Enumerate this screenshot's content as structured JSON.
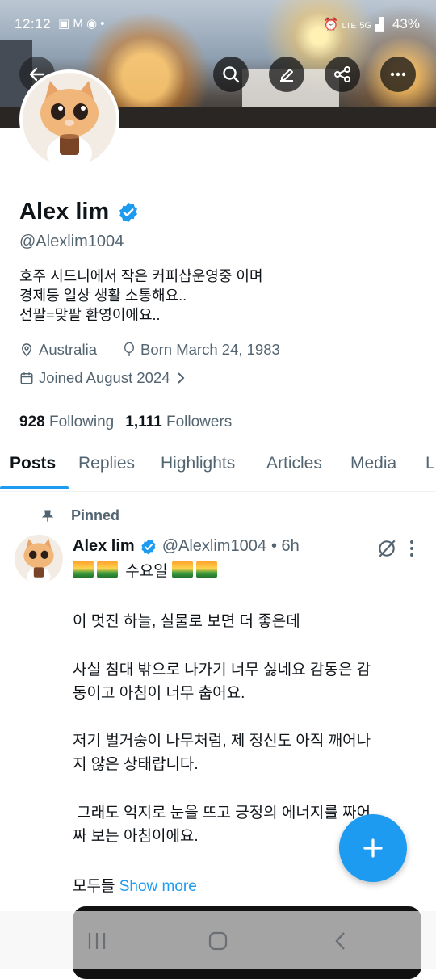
{
  "status_bar": {
    "time": "12:12",
    "left_icons": [
      "image-icon",
      "gmail-icon",
      "chat-icon",
      "dot-icon"
    ],
    "right_icons": [
      "alarm-icon",
      "volte-icon",
      "5g-icon",
      "signal-icon"
    ],
    "battery": "43%"
  },
  "top_actions": [
    "back-icon",
    "search-icon",
    "edit-icon",
    "share-icon",
    "more-icon"
  ],
  "profile": {
    "name": "Alex lim",
    "handle": "@Alexlim1004",
    "bio": "호주 시드니에서 작은 커피샵운영중 이며\n 경제등 일상 생활 소통해요..\n선팔=맞팔 환영이에요..",
    "location": "Australia",
    "born": "Born March 24, 1983",
    "joined": "Joined August 2024",
    "following_count": "928",
    "following_label": "Following",
    "followers_count": "1,111",
    "followers_label": "Followers",
    "verified_color": "#1d9bf0"
  },
  "tabs": [
    {
      "label": "Posts",
      "active": true
    },
    {
      "label": "Replies"
    },
    {
      "label": "Highlights"
    },
    {
      "label": "Articles"
    },
    {
      "label": "Media"
    },
    {
      "label": "L"
    }
  ],
  "pinned_post": {
    "pinned_label": "Pinned",
    "name": "Alex lim",
    "handle": "@Alexlim1004",
    "time": "• 6h",
    "line1": "수요일",
    "para1": "이 멋진 하늘, 실물로 보면 더 좋은데",
    "para2_a": "사실 침대 밖으로 나가기 너무 싫네요 감동은 감",
    "para2_b": "동이고 아침이 너무 춥어요.",
    "para3_a": "저기 벌거숭이 나무처럼, 제 정신도 아직 깨어나",
    "para3_b": "지 않은 상태랍니다.",
    "para4_a": " 그래도 억지로 눈을 뜨고 긍정의 에너지를 짜어",
    "para4_b": "짜 보는 아침이에요.",
    "last_line": "모두들",
    "show_more": "Show more"
  },
  "colors": {
    "accent": "#1d9bf0",
    "text": "#0f1419",
    "muted": "#536471"
  }
}
